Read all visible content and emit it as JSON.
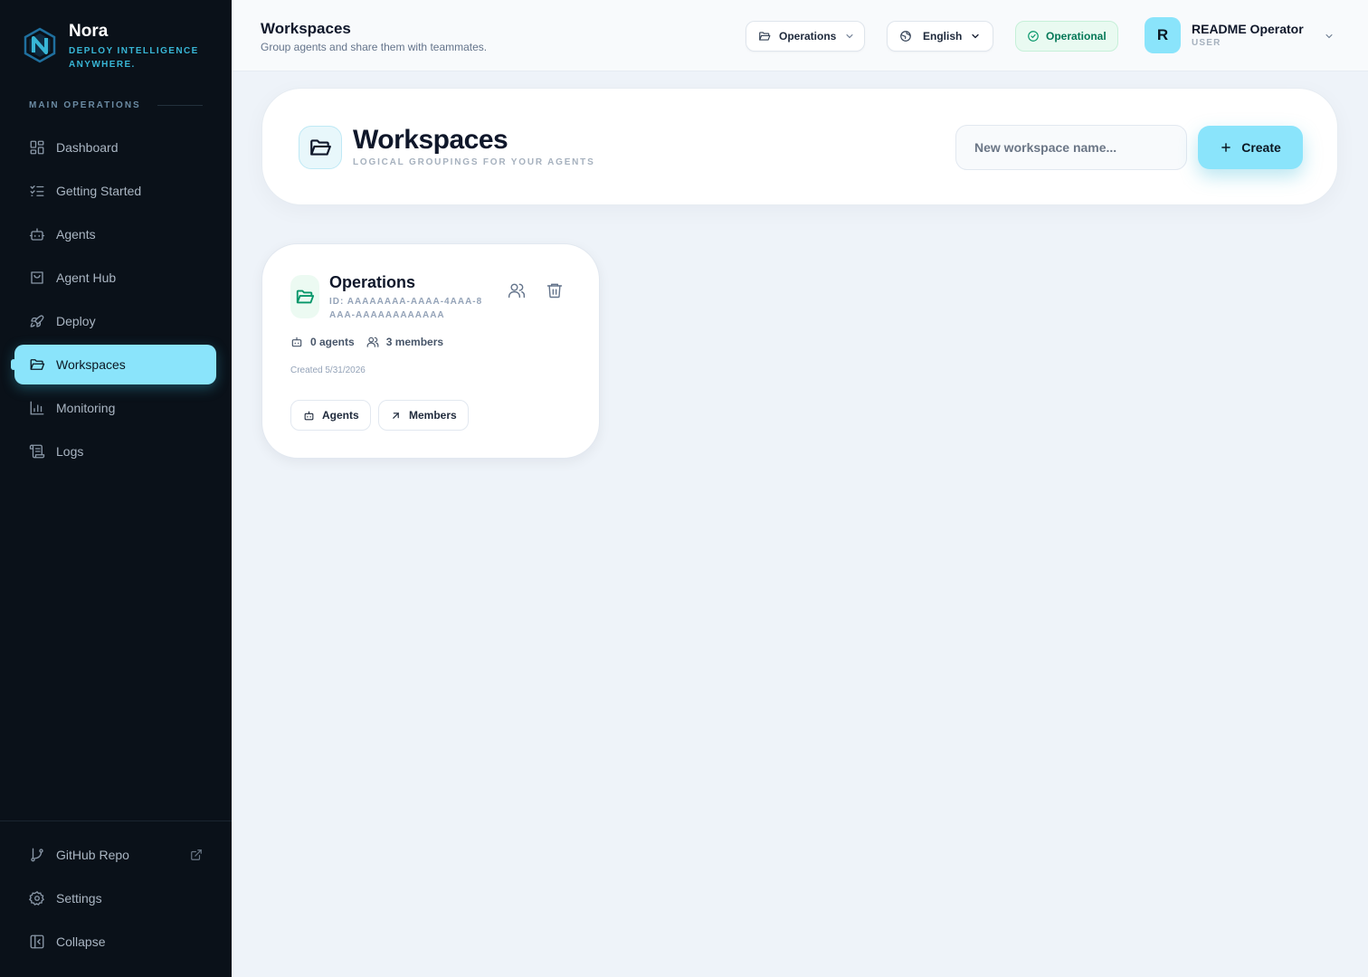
{
  "brand": {
    "name": "Nora",
    "tagline": "DEPLOY INTELLIGENCE ANYWHERE.",
    "logo_icon": "nora-logo-icon"
  },
  "sidebar": {
    "section_label": "MAIN OPERATIONS",
    "items": [
      {
        "label": "Dashboard",
        "icon": "dashboard-icon",
        "active": false
      },
      {
        "label": "Getting Started",
        "icon": "checklist-icon",
        "active": false
      },
      {
        "label": "Agents",
        "icon": "bot-icon",
        "active": false
      },
      {
        "label": "Agent Hub",
        "icon": "shopping-bag-icon",
        "active": false
      },
      {
        "label": "Deploy",
        "icon": "rocket-icon",
        "active": false
      },
      {
        "label": "Workspaces",
        "icon": "folder-open-icon",
        "active": true
      },
      {
        "label": "Monitoring",
        "icon": "bar-chart-icon",
        "active": false
      },
      {
        "label": "Logs",
        "icon": "scroll-icon",
        "active": false
      }
    ],
    "bottom": [
      {
        "label": "GitHub Repo",
        "icon": "git-branch-icon",
        "external": true
      },
      {
        "label": "Settings",
        "icon": "gear-icon"
      },
      {
        "label": "Collapse",
        "icon": "sidebar-collapse-icon"
      }
    ]
  },
  "topbar": {
    "title": "Workspaces",
    "subtitle": "Group agents and share them with teammates.",
    "workspace_selector": "Operations",
    "language_selector": "English",
    "status": "Operational",
    "status_color": "#047857",
    "user": {
      "initial": "R",
      "name": "README Operator",
      "role": "USER"
    }
  },
  "hero": {
    "title": "Workspaces",
    "subtitle": "LOGICAL GROUPINGS FOR YOUR AGENTS",
    "input_placeholder": "New workspace name...",
    "input_value": "",
    "create_label": "Create"
  },
  "workspaces": [
    {
      "name": "Operations",
      "id_label": "ID: AAAAAAAA-AAAA-4AAA-8AAA-AAAAAAAAAAAA",
      "agents": "0 agents",
      "members": "3 members",
      "created": "Created 5/31/2026",
      "agents_button": "Agents",
      "members_button": "Members"
    }
  ],
  "colors": {
    "accent": "#8ae4fb",
    "sidebar_bg": "#0a1119",
    "brand_tag": "#38b6d6",
    "workspace_icon": "#059669"
  }
}
